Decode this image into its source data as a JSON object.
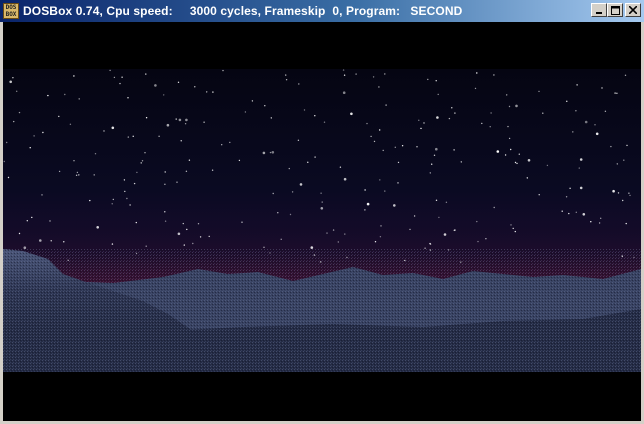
{
  "window": {
    "title": "DOSBox 0.74, Cpu speed:     3000 cycles, Frameskip  0, Program:   SECOND",
    "icon_label": "DOS BOX",
    "buttons": {
      "minimize": "minimize-icon",
      "maximize": "maximize-icon",
      "close": "close-icon"
    }
  },
  "scene": {
    "description_icon": "night-sky-landscape",
    "colors": {
      "sky_top": "#050512",
      "horizon_glow": "#3a1030",
      "terrain": "#2d3550",
      "terrain_light": "#5a6688"
    }
  }
}
